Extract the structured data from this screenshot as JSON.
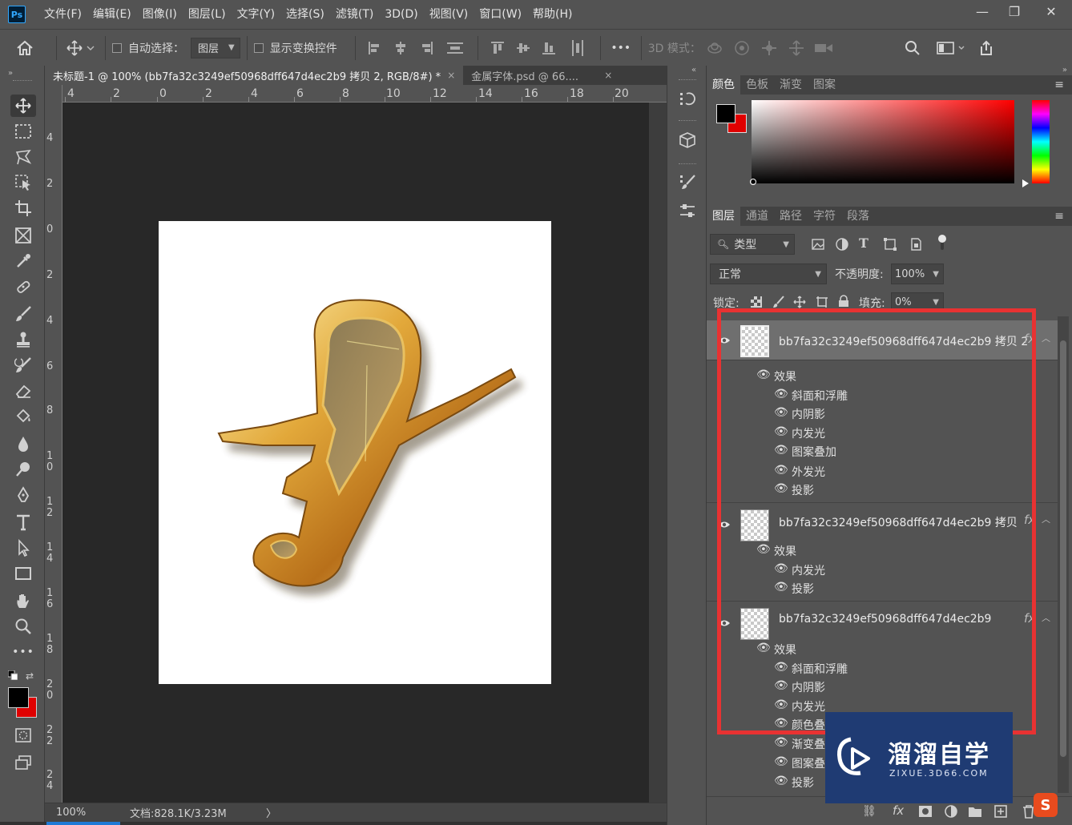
{
  "app": {
    "logo": "Ps"
  },
  "menu": [
    "文件(F)",
    "编辑(E)",
    "图像(I)",
    "图层(L)",
    "文字(Y)",
    "选择(S)",
    "滤镜(T)",
    "3D(D)",
    "视图(V)",
    "窗口(W)",
    "帮助(H)"
  ],
  "window_controls": {
    "minimize": "—",
    "restore": "❐",
    "close": "✕"
  },
  "options": {
    "auto_select_label": "自动选择：",
    "auto_select_value": "图层",
    "show_transform_label": "显示变换控件",
    "more": "•••",
    "mode_3d_label": "3D 模式："
  },
  "tabs": [
    {
      "title": "未标题-1 @ 100% (bb7fa32c3249ef50968dff647d4ec2b9 拷贝 2, RGB/8#) *",
      "close": "×"
    },
    {
      "title": "金属字体.psd @ 66....",
      "close": "×"
    }
  ],
  "ruler": {
    "top": [
      "4",
      "2",
      "0",
      "2",
      "4",
      "6",
      "8",
      "10",
      "12",
      "14",
      "16",
      "18",
      "20"
    ],
    "left": [
      "4",
      "2",
      "0",
      "2",
      "4",
      "6",
      "8",
      "1\n0",
      "1\n2",
      "1\n4",
      "1\n6",
      "1\n8",
      "2\n0",
      "2\n2",
      "2\n4"
    ]
  },
  "status": {
    "zoom": "100%",
    "doc_info": "文档:828.1K/3.23M",
    "arrow": "〉"
  },
  "color_panel": {
    "tabs": [
      "颜色",
      "色板",
      "渐变",
      "图案"
    ],
    "foreground": "#000000",
    "background": "#e00000",
    "hue": "#ff0000"
  },
  "layers_panel": {
    "tabs": [
      "图层",
      "通道",
      "路径",
      "字符",
      "段落"
    ],
    "filter_kind": "类型",
    "blend_mode": "正常",
    "opacity_label": "不透明度:",
    "opacity_value": "100%",
    "lock_label": "锁定:",
    "fill_label": "填充:",
    "fill_value": "0%",
    "layers": [
      {
        "name": "bb7fa32c3249ef50968dff647d4ec2b9 拷贝 2",
        "selected": true,
        "effects_label": "效果",
        "effects": [
          "斜面和浮雕",
          "内阴影",
          "内发光",
          "图案叠加",
          "外发光",
          "投影"
        ]
      },
      {
        "name": "bb7fa32c3249ef50968dff647d4ec2b9 拷贝",
        "selected": false,
        "effects_label": "效果",
        "effects": [
          "内发光",
          "投影"
        ]
      },
      {
        "name": "bb7fa32c3249ef50968dff647d4ec2b9",
        "selected": false,
        "effects_label": "效果",
        "effects": [
          "斜面和浮雕",
          "内阴影",
          "内发光",
          "颜色叠加",
          "渐变叠加",
          "图案叠加",
          "投影"
        ]
      }
    ],
    "fx_label": "fx"
  },
  "watermark": {
    "cn": "溜溜自学",
    "en": "ZIXUE.3D66.COM"
  },
  "brand_corner": "S",
  "colors": {
    "accent_highlight": "#e83232",
    "watermark_bg": "#1f3b73",
    "gold": "#d9a12a"
  }
}
